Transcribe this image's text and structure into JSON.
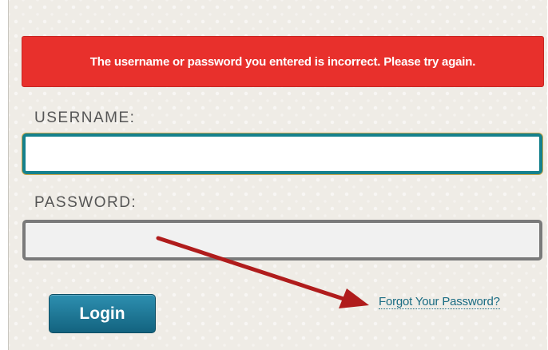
{
  "error": {
    "message": "The username or password you entered is incorrect. Please try again."
  },
  "form": {
    "username_label": "USERNAME:",
    "username_value": "",
    "password_label": "PASSWORD:",
    "password_value": "",
    "login_label": "Login",
    "forgot_link": "Forgot Your Password?"
  },
  "colors": {
    "error_background": "#e8302c",
    "focused_border": "#14818d",
    "button": "#13637f",
    "annotation_arrow": "#b01c1c"
  },
  "icons": {
    "annotation": "red-arrow-icon"
  }
}
